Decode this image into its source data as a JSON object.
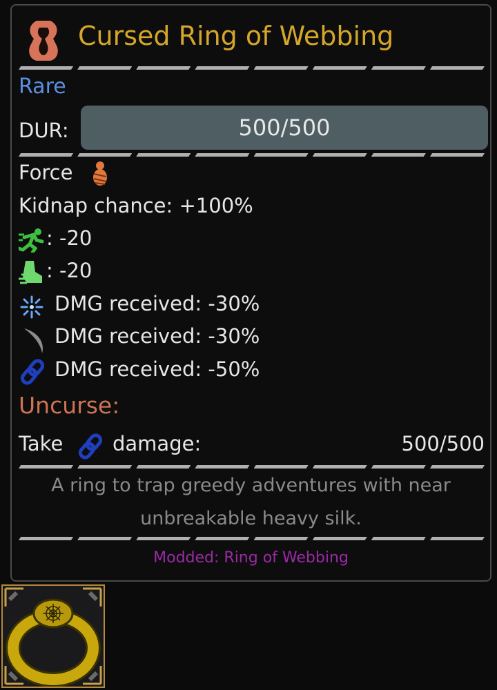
{
  "item": {
    "name": "Cursed Ring of Webbing",
    "rarity": "Rare",
    "durability_label": "DUR:",
    "durability_text": "500/500",
    "durability_fraction": 1.0,
    "force_label": "Force",
    "kidnap": "Kidnap chance: +100%",
    "speed_stat": ": -20",
    "evasion_stat": ": -20",
    "dmg_magic": "DMG received: -30%",
    "dmg_slash": "DMG received: -30%",
    "dmg_bind": "DMG received: -50%",
    "uncurse_label": "Uncurse:",
    "uncurse_take": "Take",
    "uncurse_damage": "damage:",
    "uncurse_progress": "500/500",
    "description_line1": "A ring to trap greedy adventures with near",
    "description_line2": "unbreakable heavy silk.",
    "modded_text": "Modded: Ring of Webbing"
  },
  "colors": {
    "title": "#d4a62a",
    "rarity": "#5b8fe0",
    "uncurse": "#cd7454",
    "modded": "#9b2aa6",
    "description": "#8a8a8a"
  },
  "icons": {
    "title": "cursed-ring-icon",
    "force": "cocoon-icon",
    "speed": "running-icon",
    "evasion": "dodge-icon",
    "magic": "magic-burst-icon",
    "slash": "claw-slash-icon",
    "bind": "chain-icon",
    "slot": "web-ring-icon"
  }
}
